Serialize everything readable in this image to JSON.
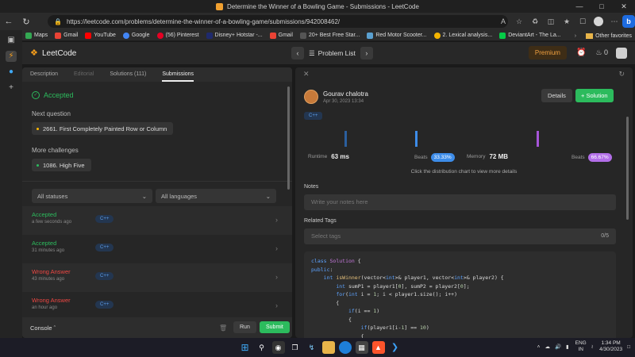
{
  "browser": {
    "window_title": "Determine the Winner of a Bowling Game - Submissions - LeetCode",
    "url": "https://leetcode.com/problems/determine-the-winner-of-a-bowling-game/submissions/942008462/",
    "bookmarks": [
      {
        "label": "Maps",
        "color": "#34a853"
      },
      {
        "label": "Gmail",
        "color": "#ea4335"
      },
      {
        "label": "YouTube",
        "color": "#ff0000"
      },
      {
        "label": "Google",
        "color": "#4285f4"
      },
      {
        "label": "(56) Pinterest",
        "color": "#e60023"
      },
      {
        "label": "Disney+ Hotstar -...",
        "color": "#1f2a6d"
      },
      {
        "label": "Gmail",
        "color": "#ea4335"
      },
      {
        "label": "20+ Best Free Star...",
        "color": "#555555"
      },
      {
        "label": "Red Motor Scooter...",
        "color": "#5aa0d0"
      },
      {
        "label": "2. Lexical analysis...",
        "color": "#f4b400"
      },
      {
        "label": "DeviantArt - The La...",
        "color": "#05cc47"
      }
    ],
    "other_favorites": "Other favorites"
  },
  "header": {
    "logo_text": "LeetCode",
    "problem_list": "Problem List",
    "premium": "Premium",
    "streak": "0"
  },
  "left": {
    "tabs": [
      {
        "label": "Description",
        "state": "normal"
      },
      {
        "label": "Editorial",
        "state": "disabled"
      },
      {
        "label": "Solutions (111)",
        "state": "normal"
      },
      {
        "label": "Submissions",
        "state": "active"
      }
    ],
    "status": "Accepted",
    "next_question_label": "Next question",
    "next_question": "2661. First Completely Painted Row or Column",
    "more_challenges_label": "More challenges",
    "more_challenge": "1086. High Five",
    "filter_status": "All statuses",
    "filter_language": "All languages",
    "submissions": [
      {
        "status": "Accepted",
        "time": "a few seconds ago",
        "lang": "C++",
        "color": "#2cbb5d"
      },
      {
        "status": "Accepted",
        "time": "31 minutes ago",
        "lang": "C++",
        "color": "#2cbb5d"
      },
      {
        "status": "Wrong Answer",
        "time": "43 minutes ago",
        "lang": "C++",
        "color": "#ef4743"
      },
      {
        "status": "Wrong Answer",
        "time": "an hour ago",
        "lang": "C++",
        "color": "#ef4743"
      }
    ],
    "console": "Console",
    "run": "Run",
    "submit": "Submit"
  },
  "right": {
    "user_name": "Gourav chalotra",
    "date": "Apr 30, 2023 13:34",
    "details": "Details",
    "solution": "+ Solution",
    "lang": "C++",
    "runtime_label": "Runtime",
    "runtime_value": "63 ms",
    "runtime_beats_label": "Beats",
    "runtime_beats": "33.33%",
    "memory_label": "Memory",
    "memory_value": "72 MB",
    "memory_beats_label": "Beats",
    "memory_beats": "66.67%",
    "hint": "Click the distribution chart to view more details",
    "notes_label": "Notes",
    "notes_placeholder": "Write your notes here",
    "tags_label": "Related Tags",
    "tags_placeholder": "Select tags",
    "tags_count": "0/5"
  },
  "taskbar": {
    "lang_top": "ENG",
    "lang_bottom": "IN",
    "time": "1:34 PM",
    "date": "4/30/2023"
  }
}
